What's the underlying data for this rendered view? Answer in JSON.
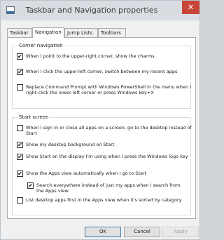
{
  "window": {
    "title": "Taskbar and Navigation properties",
    "close_symbol": "✕"
  },
  "tabs": [
    {
      "label": "Taskbar",
      "active": false
    },
    {
      "label": "Navigation",
      "active": true
    },
    {
      "label": "Jump Lists",
      "active": false
    },
    {
      "label": "Toolbars",
      "active": false
    }
  ],
  "corner_navigation": {
    "heading": "Corner navigation",
    "options": [
      {
        "label": "When I point to the upper-right corner, show the charms",
        "checked": true
      },
      {
        "label": "When I click the upper-left corner, switch between my recent apps",
        "checked": true
      },
      {
        "label": "Replace Command Prompt with Windows PowerShell in the menu when I right-click the lower-left corner or press Windows key+X",
        "checked": false
      }
    ]
  },
  "start_screen": {
    "heading": "Start screen",
    "options": [
      {
        "label": "When I sign in or close all apps on a screen, go to the desktop instead of Start",
        "checked": false
      },
      {
        "label": "Show my desktop background on Start",
        "checked": true
      },
      {
        "label": "Show Start on the display I'm using when I press the Windows logo key",
        "checked": true
      },
      {
        "label": "Show the Apps view automatically when I go to Start",
        "checked": true
      },
      {
        "label": "Search everywhere instead of just my apps when I search from the Apps view",
        "checked": true
      },
      {
        "label": "List desktop apps first in the Apps view when it's sorted by category",
        "checked": false
      }
    ]
  },
  "buttons": {
    "ok": "OK",
    "cancel": "Cancel",
    "apply": "Apply"
  }
}
